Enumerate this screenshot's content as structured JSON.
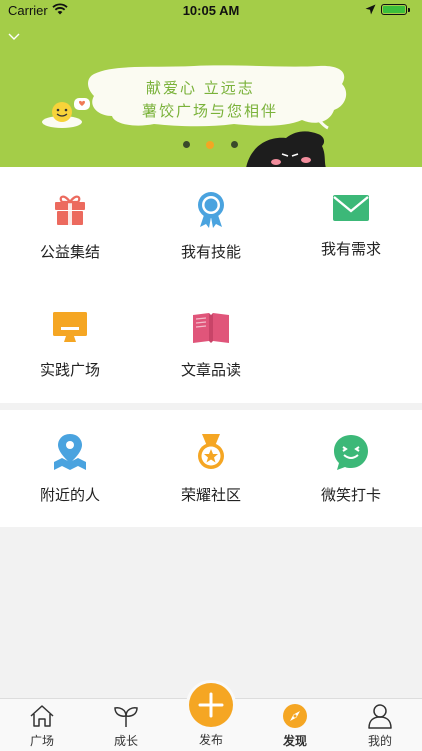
{
  "status_bar": {
    "carrier": "Carrier",
    "time": "10:05 AM"
  },
  "banner": {
    "slogan_line1": "献爱心  立远志",
    "slogan_line2": "薯饺广场与您相伴",
    "page_count": 3,
    "active_page": 2,
    "background_color": "#a4cd48"
  },
  "grid": {
    "section1": [
      {
        "label": "公益集结",
        "icon": "gift-icon",
        "color": "#ec6a5e"
      },
      {
        "label": "我有技能",
        "icon": "ribbon-badge-icon",
        "color": "#4aa3df"
      },
      {
        "label": "我有需求",
        "icon": "envelope-icon",
        "color": "#3cb878"
      },
      {
        "label": "实践广场",
        "icon": "monitor-icon",
        "color": "#f5a623"
      },
      {
        "label": "文章品读",
        "icon": "open-book-icon",
        "color": "#e0557a"
      }
    ],
    "section2": [
      {
        "label": "附近的人",
        "icon": "map-pin-icon",
        "color": "#4aa3df"
      },
      {
        "label": "荣耀社区",
        "icon": "medal-icon",
        "color": "#f5a623"
      },
      {
        "label": "微笑打卡",
        "icon": "smile-chat-icon",
        "color": "#3cb878"
      }
    ]
  },
  "tabbar": {
    "items": [
      {
        "label": "广场",
        "icon": "home-icon"
      },
      {
        "label": "成长",
        "icon": "sprout-icon"
      },
      {
        "label": "发布",
        "icon": "plus-icon"
      },
      {
        "label": "发现",
        "icon": "compass-icon"
      },
      {
        "label": "我的",
        "icon": "person-icon"
      }
    ],
    "active_index": 3,
    "accent_color": "#f5a623"
  }
}
